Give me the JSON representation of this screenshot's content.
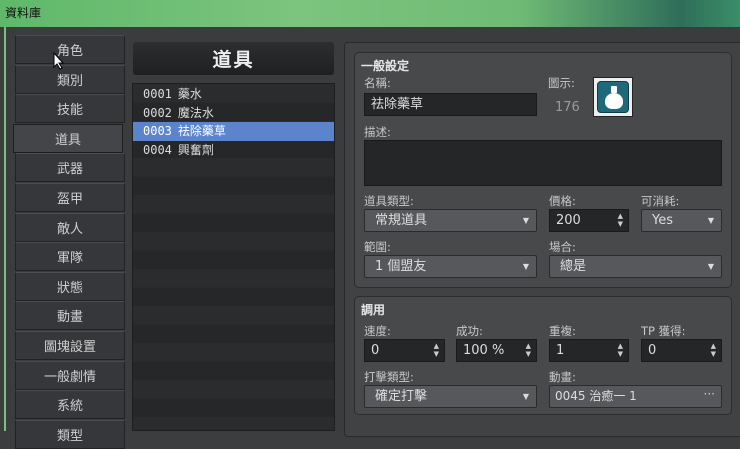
{
  "window": {
    "title": "資料庫"
  },
  "tabs": [
    "角色",
    "類別",
    "技能",
    "道具",
    "武器",
    "盔甲",
    "敵人",
    "軍隊",
    "狀態",
    "動畫",
    "圖塊設置",
    "一般劇情",
    "系統",
    "類型"
  ],
  "selected_tab": "道具",
  "list": {
    "title": "道具",
    "items": [
      {
        "id": "0001",
        "name": "藥水"
      },
      {
        "id": "0002",
        "name": "魔法水"
      },
      {
        "id": "0003",
        "name": "祛除藥草"
      },
      {
        "id": "0004",
        "name": "興奮劑"
      }
    ],
    "selected_index": 2
  },
  "general": {
    "title": "一般設定",
    "name_label": "名稱:",
    "name_value": "祛除藥草",
    "icon_label": "圖示:",
    "icon_index": "176",
    "desc_label": "描述:",
    "desc_value": "",
    "itype_label": "道具類型:",
    "itype_value": "常規道具",
    "price_label": "價格:",
    "price_value": "200",
    "consumable_label": "可消耗:",
    "consumable_value": "Yes",
    "scope_label": "範圍:",
    "scope_value": "1 個盟友",
    "occasion_label": "場合:",
    "occasion_value": "總是"
  },
  "invocation": {
    "title": "調用",
    "speed_label": "速度:",
    "speed_value": "0",
    "success_label": "成功:",
    "success_value": "100 %",
    "repeat_label": "重複:",
    "repeat_value": "1",
    "tp_label": "TP 獲得:",
    "tp_value": "0",
    "hittype_label": "打擊類型:",
    "hittype_value": "確定打擊",
    "anim_label": "動畫:",
    "anim_value": "0045 治癒一 1",
    "anim_more": "···"
  },
  "colors": {
    "selection": "#5b84cc",
    "icon_bg": "#1f6a7a"
  }
}
